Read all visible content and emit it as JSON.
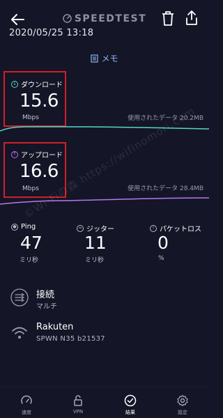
{
  "header": {
    "brand": "SPEEDTEST",
    "datetime": "2020/05/25 13:18",
    "memo_label": "メモ"
  },
  "download": {
    "label": "ダウンロード",
    "value": "15.6",
    "unit": "Mbps",
    "data_used": "使用されたデータ 20.2MB",
    "color": "#57d6c8"
  },
  "upload": {
    "label": "アップロード",
    "value": "16.6",
    "unit": "Mbps",
    "data_used": "使用されたデータ 28.4MB",
    "color": "#b578f0"
  },
  "ping": {
    "label": "Ping",
    "value": "47",
    "unit": "ミリ秒"
  },
  "jitter": {
    "label": "ジッター",
    "value": "11",
    "unit": "ミリ秒"
  },
  "packet_loss": {
    "label": "パケットロス",
    "value": "0",
    "unit": "%"
  },
  "connection": {
    "title": "接続",
    "subtitle": "マルチ"
  },
  "network": {
    "name": "Rakuten",
    "details": "SPWN N35 b21537"
  },
  "watermark": "©Wi-Fiの森 https://wifinomori.com",
  "nav": {
    "items": [
      {
        "label": "速度",
        "icon": "speedometer-icon"
      },
      {
        "label": "VPN",
        "icon": "lock-icon"
      },
      {
        "label": "結果",
        "icon": "check-circle-icon"
      },
      {
        "label": "設定",
        "icon": "gear-icon"
      }
    ],
    "active_index": 2
  },
  "colors": {
    "background": "#141526",
    "highlight_box": "#d0202a",
    "memo_accent": "#8fb3f0"
  }
}
